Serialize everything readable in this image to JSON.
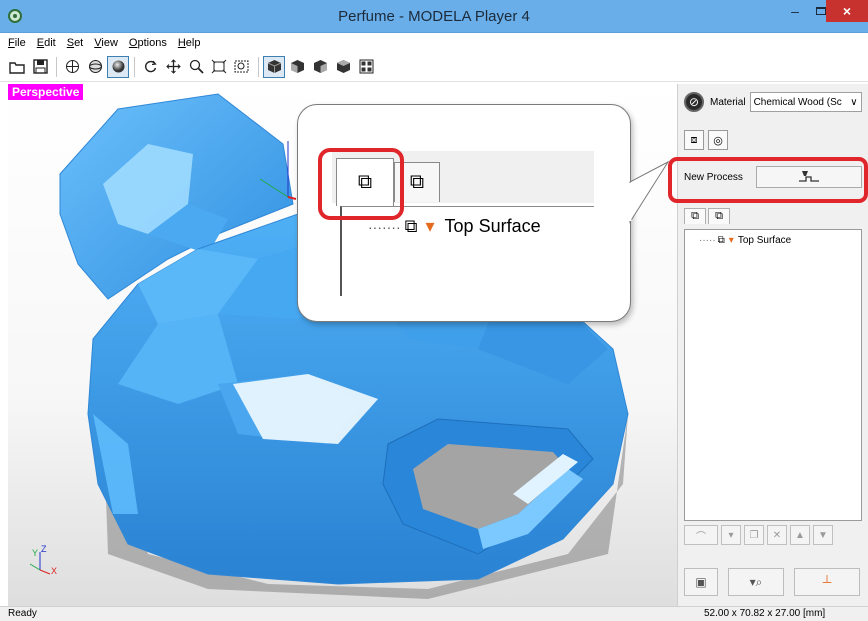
{
  "window": {
    "title": "Perfume - MODELA Player 4",
    "controls": {
      "minimize": "–",
      "close": "×"
    }
  },
  "menu": {
    "items": [
      "File",
      "Edit",
      "Set",
      "View",
      "Options",
      "Help"
    ]
  },
  "toolbar": {
    "icons": [
      "open-folder-icon",
      "save-icon",
      "globe-wireframe-icon",
      "globe-shaded-icon",
      "sphere-solid-icon",
      "rotate-icon",
      "pan-icon",
      "zoom-icon",
      "fit-icon",
      "zoom-box-icon",
      "view-iso-icon",
      "view-front-icon",
      "view-side-icon",
      "view-top-icon",
      "view-grid-icon"
    ],
    "active_icon": "sphere-solid-icon"
  },
  "viewport": {
    "view_label": "Perspective",
    "axes": {
      "y": "Y",
      "z": "Z",
      "x": "X"
    },
    "model_color": "#3aa3ef",
    "label_color": "#ff00ff"
  },
  "panel": {
    "material_label": "Material",
    "material_value": "Chemical Wood (Sc",
    "new_process_label": "New Process",
    "new_process_icon": "tool-path-icon",
    "tree_tabs": [
      "model-tab-icon",
      "process-tab-icon"
    ],
    "tree_items": [
      {
        "label": "Top Surface"
      }
    ],
    "tree_action_icons": [
      "add-path-icon",
      "filter-icon",
      "copy-icon",
      "delete-icon",
      "move-up-icon",
      "move-down-icon"
    ],
    "bottom_icons": [
      "preview-icon",
      "search-tool-icon",
      "cut-icon"
    ]
  },
  "callout": {
    "tree_item_label": "Top Surface",
    "highlight_color": "#e0262a"
  },
  "status": {
    "text": "Ready",
    "dimensions": "52.00 x 70.82 x 27.00 [mm]"
  }
}
